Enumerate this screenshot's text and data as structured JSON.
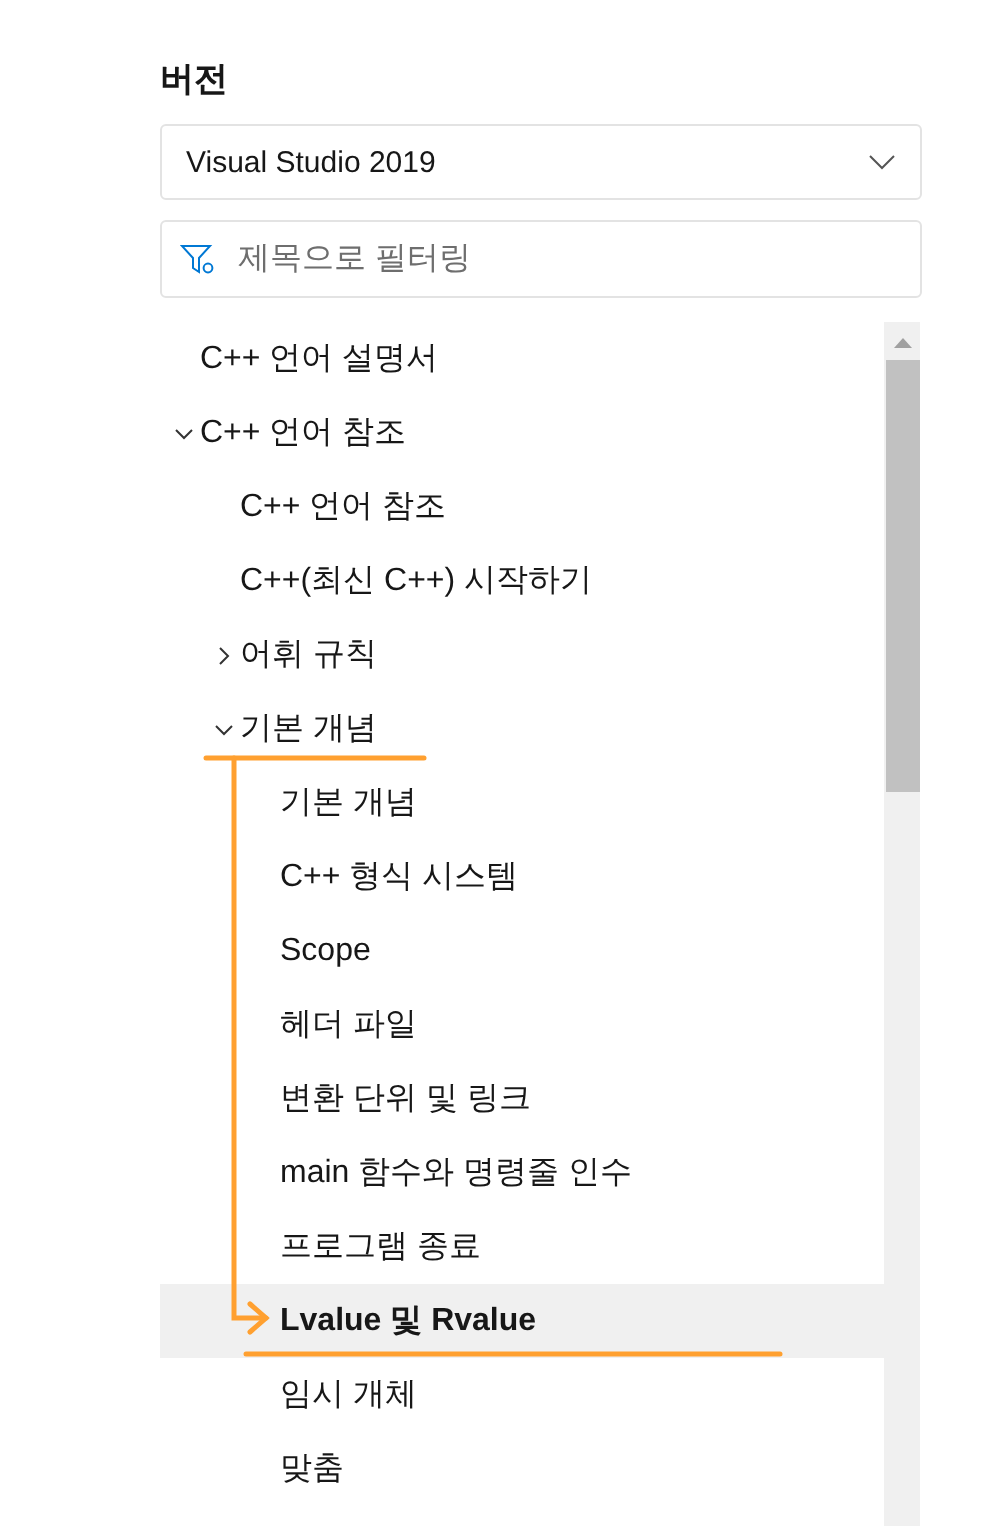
{
  "version": {
    "heading": "버전",
    "selected_value": "Visual Studio 2019"
  },
  "filter": {
    "placeholder": "제목으로 필터링"
  },
  "toc": [
    {
      "label": "C++ 언어 설명서",
      "selected": false
    },
    {
      "label": "C++ 언어 참조",
      "selected": false,
      "expanded": true,
      "children": [
        {
          "label": "C++ 언어 참조",
          "selected": false
        },
        {
          "label": "C++(최신 C++) 시작하기",
          "selected": false
        },
        {
          "label": "어휘 규칙",
          "selected": false,
          "expanded": false
        },
        {
          "label": "기본 개념",
          "selected": false,
          "expanded": true,
          "children": [
            {
              "label": "기본 개념",
              "selected": false
            },
            {
              "label": "C++ 형식 시스템",
              "selected": false
            },
            {
              "label": "Scope",
              "selected": false
            },
            {
              "label": "헤더 파일",
              "selected": false
            },
            {
              "label": "변환 단위 및 링크",
              "selected": false
            },
            {
              "label": "main 함수와 명령줄 인수",
              "selected": false
            },
            {
              "label": "프로그램 종료",
              "selected": false
            },
            {
              "label": "Lvalue 및 Rvalue",
              "selected": true
            },
            {
              "label": "임시 개체",
              "selected": false
            },
            {
              "label": "맞춤",
              "selected": false
            }
          ]
        }
      ]
    }
  ]
}
